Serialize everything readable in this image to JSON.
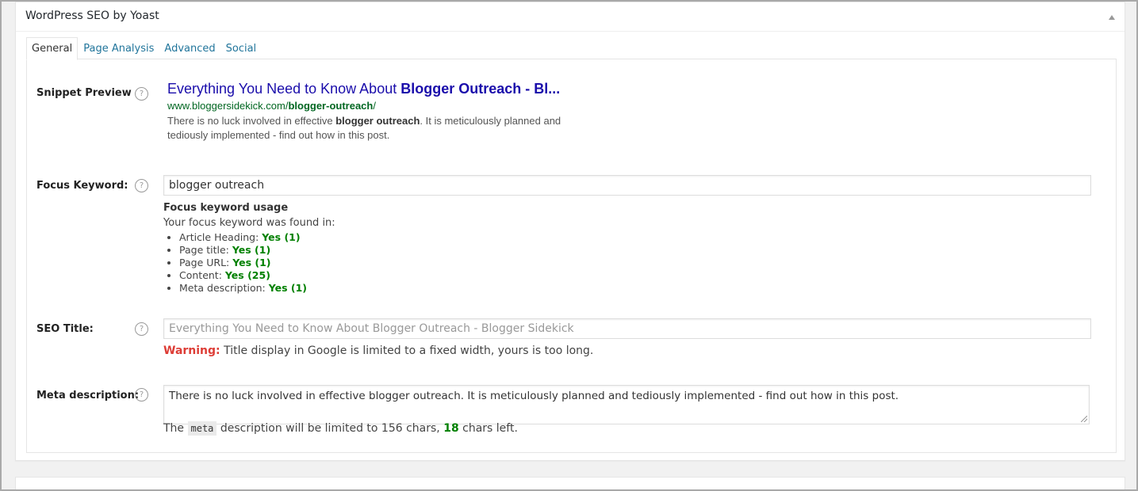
{
  "metabox": {
    "title": "WordPress SEO by Yoast"
  },
  "tabs": [
    {
      "label": "General",
      "active": true
    },
    {
      "label": "Page Analysis",
      "active": false
    },
    {
      "label": "Advanced",
      "active": false
    },
    {
      "label": "Social",
      "active": false
    }
  ],
  "labels": {
    "snippet_preview": "Snippet Preview",
    "focus_keyword": "Focus Keyword:",
    "seo_title": "SEO Title:",
    "meta_description": "Meta description:",
    "help": "?"
  },
  "snippet": {
    "title_prefix": "Everything You Need to Know About ",
    "title_bold": "Blogger Outreach - Bl...",
    "url_prefix": "www.bloggersidekick.com/",
    "url_bold": "blogger-outreach",
    "url_suffix": "/",
    "desc_prefix": "There is no luck involved in effective ",
    "desc_bold": "blogger outreach",
    "desc_suffix": ". It is meticulously planned and tediously implemented - find out how in this post."
  },
  "focus_keyword": {
    "value": "blogger outreach",
    "usage_heading": "Focus keyword usage",
    "usage_intro": "Your focus keyword was found in:",
    "items": [
      {
        "label": "Article Heading: ",
        "result": "Yes (1)"
      },
      {
        "label": "Page title: ",
        "result": "Yes (1)"
      },
      {
        "label": "Page URL: ",
        "result": "Yes (1)"
      },
      {
        "label": "Content: ",
        "result": "Yes (25)"
      },
      {
        "label": "Meta description: ",
        "result": "Yes (1)"
      }
    ]
  },
  "seo_title": {
    "placeholder": "Everything You Need to Know About Blogger Outreach  - Blogger Sidekick",
    "warning_label": "Warning:",
    "warning_text": " Title display in Google is limited to a fixed width, yours is too long."
  },
  "meta_description": {
    "value": "There is no luck involved in effective blogger outreach. It is meticulously planned and tediously implemented - find out how in this post.",
    "count_prefix": "The ",
    "count_code": "meta",
    "count_middle": " description will be limited to 156 chars, ",
    "count_number": "18",
    "count_suffix": " chars left."
  },
  "colors": {
    "link": "#21759b",
    "snippet_title": "#1a0dab",
    "snippet_url": "#006621",
    "good": "#008000",
    "warning": "#dd3d36"
  }
}
